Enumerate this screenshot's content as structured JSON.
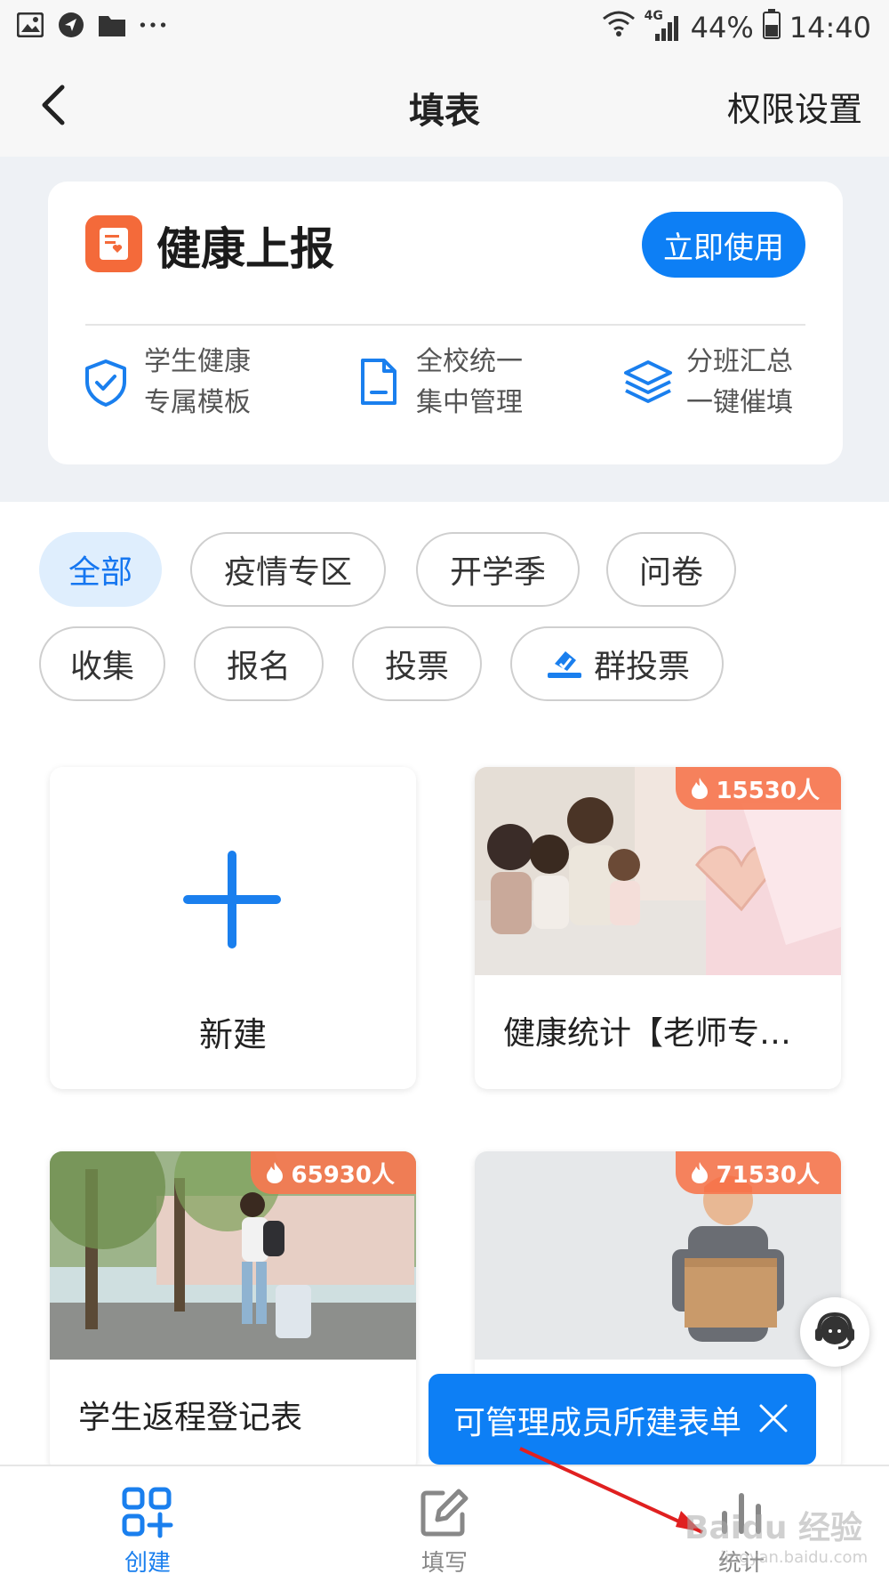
{
  "status_bar": {
    "signal_label": "4G",
    "battery": "44%",
    "time": "14:40",
    "left_icons": [
      "image-icon",
      "location-icon",
      "folder-icon",
      "more-dots-icon"
    ]
  },
  "header": {
    "title": "填表",
    "right_action": "权限设置"
  },
  "banner": {
    "title": "健康上报",
    "button": "立即使用",
    "features": [
      {
        "icon": "shield-check-icon",
        "line1": "学生健康",
        "line2": "专属模板"
      },
      {
        "icon": "document-icon",
        "line1": "全校统一",
        "line2": "集中管理"
      },
      {
        "icon": "layers-icon",
        "line1": "分班汇总",
        "line2": "一键催填"
      }
    ]
  },
  "categories": [
    {
      "label": "全部",
      "active": true
    },
    {
      "label": "疫情专区",
      "active": false
    },
    {
      "label": "开学季",
      "active": false
    },
    {
      "label": "问卷",
      "active": false
    },
    {
      "label": "收集",
      "active": false
    },
    {
      "label": "报名",
      "active": false
    },
    {
      "label": "投票",
      "active": false
    },
    {
      "label": "群投票",
      "active": false
    }
  ],
  "templates": {
    "new_label": "新建",
    "items": [
      {
        "name": "健康统计【老师专…",
        "hot": "15530人"
      },
      {
        "name": "学生返程登记表",
        "hot": "65930人"
      },
      {
        "name": "",
        "hot": "71530人"
      }
    ]
  },
  "tooltip": {
    "text": "可管理成员所建表单"
  },
  "bottom_nav": {
    "items": [
      {
        "label": "创建",
        "active": true
      },
      {
        "label": "填写",
        "active": false
      },
      {
        "label": "统计",
        "active": false
      }
    ]
  },
  "watermark": {
    "text": "Baidu 经验",
    "sub": "jingyan.baidu.com"
  },
  "colors": {
    "accent": "#0d7ff5",
    "brand_orange": "#f46a3a",
    "hot_badge": "#f67850"
  }
}
